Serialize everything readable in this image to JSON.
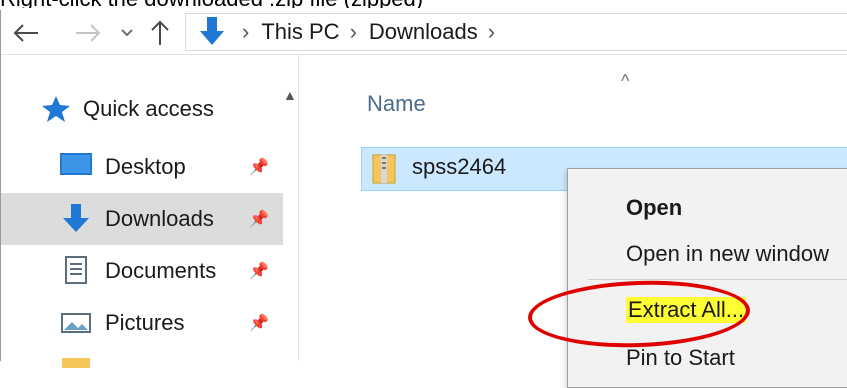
{
  "caption": {
    "text": "Right-click the downloaded .zip file (zipped)"
  },
  "toolbar": {
    "back_icon": "arrow-left-icon",
    "forward_icon": "arrow-right-icon",
    "recent_icon": "chevron-down-icon",
    "up_icon": "arrow-up-icon"
  },
  "address": {
    "crumbs": [
      "This PC",
      "Downloads"
    ],
    "separator": "›"
  },
  "navpane": {
    "quick_access": "Quick access",
    "items": [
      {
        "label": "Desktop",
        "icon": "desktop-icon"
      },
      {
        "label": "Downloads",
        "icon": "downloads-icon",
        "selected": true
      },
      {
        "label": "Documents",
        "icon": "documents-icon"
      },
      {
        "label": "Pictures",
        "icon": "pictures-icon"
      }
    ],
    "pin_glyph": "📌"
  },
  "content": {
    "column_name": "Name",
    "files": [
      {
        "name": "spss2464",
        "icon": "zip-folder-icon",
        "selected": true
      }
    ]
  },
  "context_menu": {
    "items": [
      "Open",
      "Open in new window",
      "Extract All...",
      "Pin to Start"
    ],
    "highlight_color": "#ffff33",
    "circle_color": "#e00000"
  },
  "colors": {
    "selection_bg": "#cce8ff",
    "nav_selected_bg": "#dcdcdc",
    "accent_blue": "#1e78d4"
  }
}
